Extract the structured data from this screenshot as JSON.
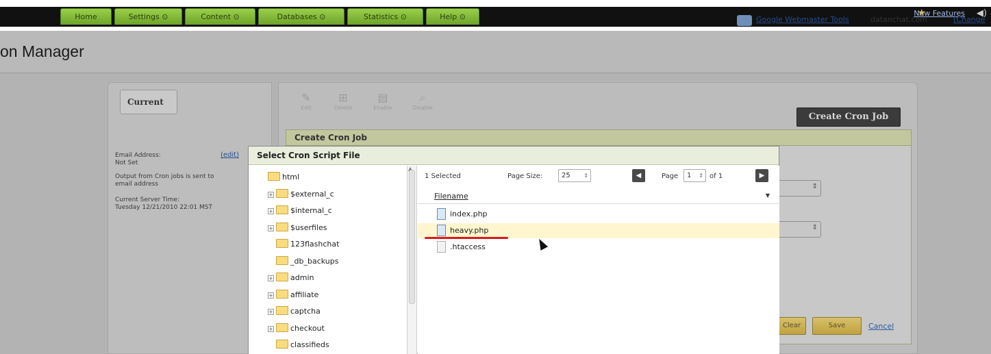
{
  "nav": {
    "tabs": [
      "Home",
      "Settings ⊙",
      "Content ⊙",
      "Databases ⊙",
      "Statistics ⊙",
      "Help ⊙"
    ],
    "new_features": "New Features"
  },
  "header": {
    "title": "on Manager",
    "webmaster_tools": "Google Webmaster Tools",
    "domain": "datanchat.com",
    "change": "(Change"
  },
  "left_panel": {
    "tab": "Current",
    "email_label": "Email Address:",
    "edit": "(edit)",
    "email_value": "Not Set",
    "output_note_line1": "Output from Cron jobs is sent to",
    "output_note_line2": "email address",
    "server_time_label": "Current Server Time:",
    "server_time_value": "Tuesday 12/21/2010 22:01 MST"
  },
  "toolbar": {
    "buttons": [
      "Edit",
      "Delete",
      "Enable",
      "Disable"
    ],
    "create_button": "Create Cron Job"
  },
  "create_cron": {
    "header": "Create Cron Job",
    "ghost_buttons": [
      "Clear",
      "Save"
    ],
    "cancel": "Cancel"
  },
  "modal": {
    "title": "Select Cron Script File",
    "tree": [
      {
        "label": "html",
        "indent": 0,
        "expander": ""
      },
      {
        "label": "$external_c",
        "indent": 1,
        "expander": "+"
      },
      {
        "label": "$internal_c",
        "indent": 1,
        "expander": "+"
      },
      {
        "label": "$userfiles",
        "indent": 1,
        "expander": "+"
      },
      {
        "label": "123flashchat",
        "indent": 1,
        "expander": ""
      },
      {
        "label": "_db_backups",
        "indent": 1,
        "expander": ""
      },
      {
        "label": "admin",
        "indent": 1,
        "expander": "+"
      },
      {
        "label": "affiliate",
        "indent": 1,
        "expander": "+"
      },
      {
        "label": "captcha",
        "indent": 1,
        "expander": "+"
      },
      {
        "label": "checkout",
        "indent": 1,
        "expander": "+"
      },
      {
        "label": "classifieds",
        "indent": 1,
        "expander": ""
      }
    ],
    "selected_count": "1 Selected",
    "page_size_label": "Page Size:",
    "page_size_value": "25",
    "page_label": "Page",
    "page_value": "1",
    "of_label": "of 1",
    "column_header": "Filename",
    "files": [
      {
        "name": "index.php",
        "selected": false
      },
      {
        "name": "heavy.php",
        "selected": true
      },
      {
        "name": ".htaccess",
        "selected": false
      }
    ]
  }
}
